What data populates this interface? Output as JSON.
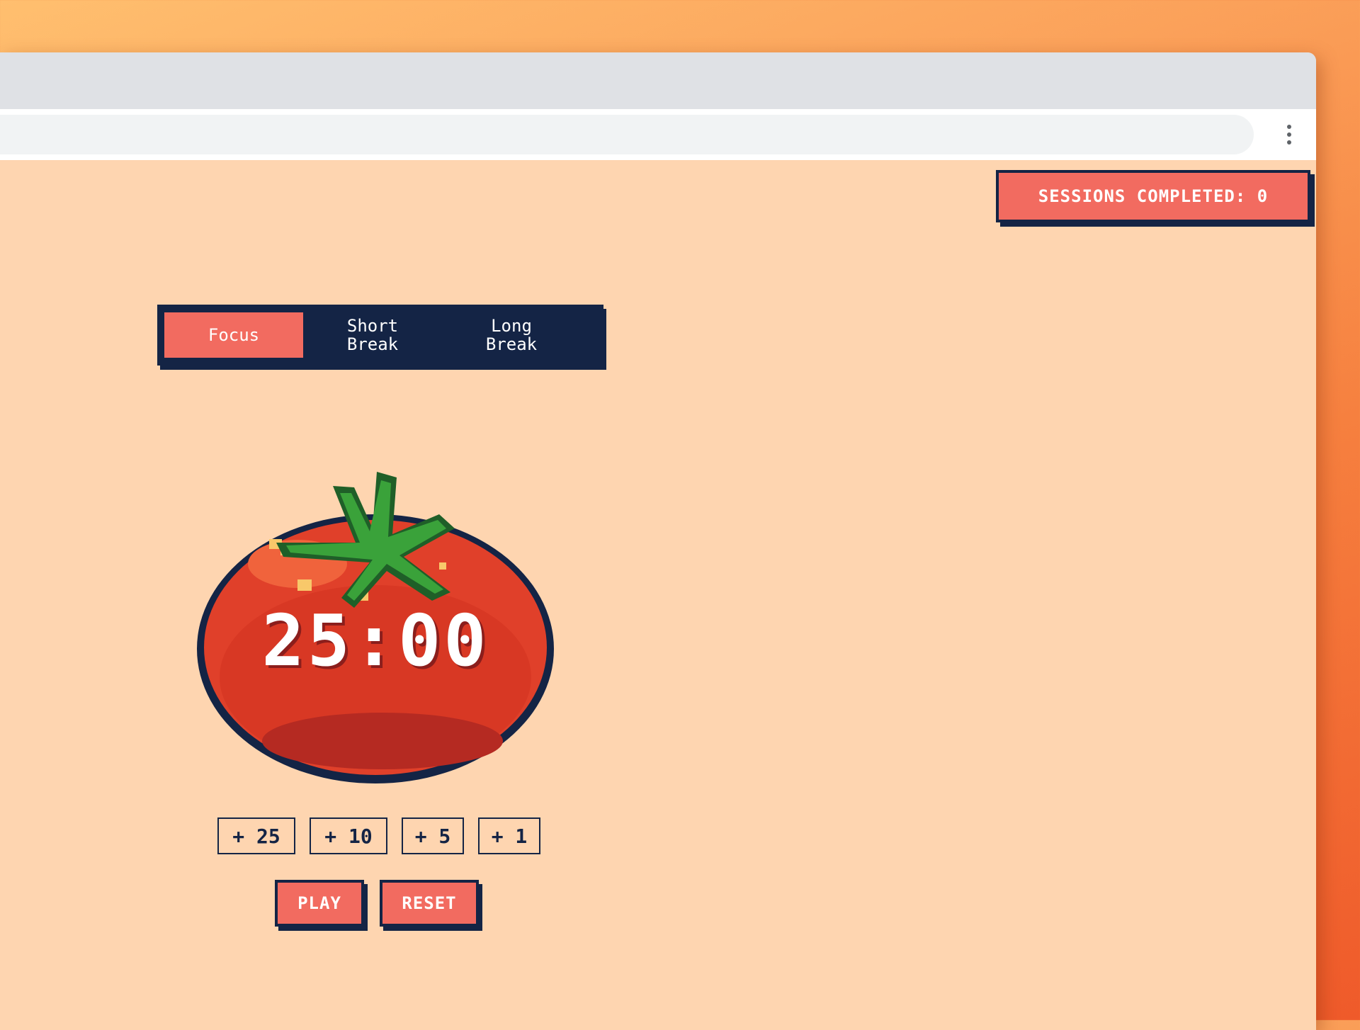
{
  "browser": {
    "menu_icon": "kebab-menu-icon"
  },
  "sessions": {
    "label": "SESSIONS COMPLETED:",
    "count": "0"
  },
  "modes": [
    {
      "line1": "Focus",
      "line2": ""
    },
    {
      "line1": "Short",
      "line2": "Break"
    },
    {
      "line1": "Long",
      "line2": "Break"
    }
  ],
  "active_mode": "Focus",
  "timer": {
    "display": "25:00"
  },
  "add_buttons": [
    "+ 25",
    "+ 10",
    "+ 5",
    "+ 1"
  ],
  "controls": {
    "play": "PLAY",
    "reset": "RESET"
  },
  "colors": {
    "accent": "#f26b60",
    "navy": "#142445",
    "background": "#fed5b0",
    "tomato": "#e0402a",
    "leaf": "#2f8f2f"
  }
}
